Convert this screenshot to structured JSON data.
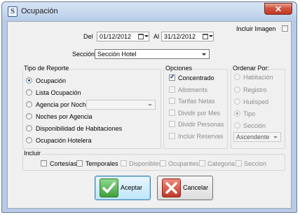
{
  "window": {
    "title": "Ocupación",
    "close_glyph": "✕",
    "app_icon": "S"
  },
  "dates": {
    "from_label": "Del",
    "from_value": "01/12/2012",
    "to_label": "Al",
    "to_value": "31/12/2012"
  },
  "include_image": {
    "label": "Incluir Imagen",
    "checked": false
  },
  "section": {
    "label": "Sección:",
    "value": "Sección Hotel"
  },
  "report_type": {
    "title": "Tipo de Reporte",
    "options": [
      {
        "label": "Ocupación",
        "selected": true
      },
      {
        "label": "Lista Ocupación",
        "selected": false
      },
      {
        "label": "Agencia por Noche",
        "selected": false
      },
      {
        "label": "Noches por Agencia",
        "selected": false
      },
      {
        "label": "Disponibilidad de Habitaciones",
        "selected": false
      },
      {
        "label": "Ocupación Hotelera",
        "selected": false
      }
    ],
    "agency_combo_value": ""
  },
  "options": {
    "title": "Opciones",
    "items": [
      {
        "label": "Concentrado",
        "checked": true,
        "enabled": true
      },
      {
        "label": "Allotments",
        "checked": false,
        "enabled": false
      },
      {
        "label": "Tarifas Netas",
        "checked": false,
        "enabled": false
      },
      {
        "label": "Dividir por Mes",
        "checked": false,
        "enabled": false
      },
      {
        "label": "Dividir Personas",
        "checked": false,
        "enabled": false
      },
      {
        "label": "Incluir Reservas",
        "checked": false,
        "enabled": false
      }
    ]
  },
  "order_by": {
    "title": "Ordenar Por:",
    "items": [
      {
        "label": "Habitación",
        "selected": false
      },
      {
        "label": "Registro",
        "selected": false
      },
      {
        "label": "Huésped",
        "selected": false
      },
      {
        "label": "Tipo",
        "selected": true
      },
      {
        "label": "Sección",
        "selected": false
      }
    ],
    "direction": "Ascendente"
  },
  "include": {
    "title": "Incluir",
    "items": [
      {
        "label": "Cortesías",
        "checked": false,
        "enabled": true
      },
      {
        "label": "Temporales",
        "checked": false,
        "enabled": true
      },
      {
        "label": "Disponibles",
        "checked": false,
        "enabled": false
      },
      {
        "label": "Ocupantes",
        "checked": false,
        "enabled": false
      },
      {
        "label": "Categoria",
        "checked": false,
        "enabled": false
      },
      {
        "label": "Seccion",
        "checked": false,
        "enabled": false
      }
    ]
  },
  "buttons": {
    "accept": "Aceptar",
    "cancel": "Cancelar"
  },
  "colors": {
    "accept_icon": "#4caf50",
    "cancel_icon": "#c0392b"
  }
}
